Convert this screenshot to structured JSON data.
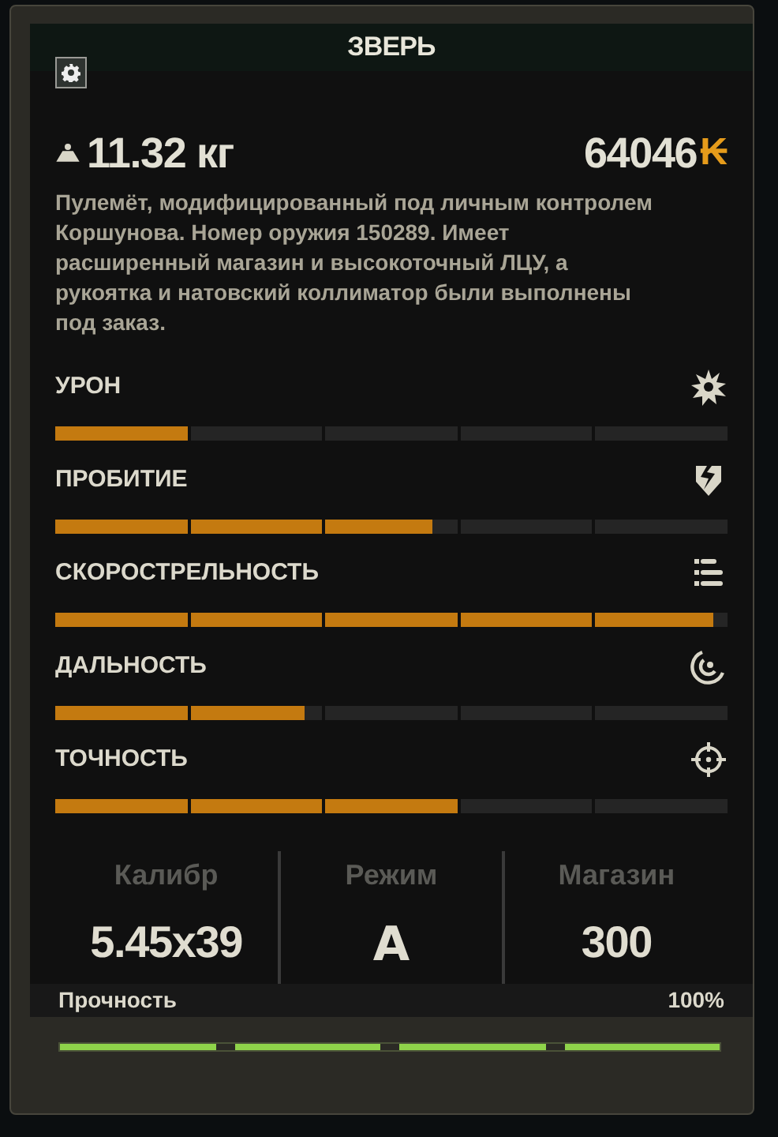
{
  "title": "ЗВЕРЬ",
  "weight": "11.32 кг",
  "price": "64046",
  "currency": "₭",
  "description": "Пулемёт, модифицированный под личным контролем Коршунова. Номер оружия 150289. Имеет расширенный магазин и высокоточный ЛЦУ, а рукоятка и натовский коллиматор были выполнены под заказ.",
  "stats": [
    {
      "label": "УРОН",
      "kind": "burst",
      "level": 0.2
    },
    {
      "label": "ПРОБИТИЕ",
      "kind": "penetration",
      "level": 0.56
    },
    {
      "label": "СКОРОСТРЕЛЬНОСТЬ",
      "kind": "rate",
      "level": 0.98
    },
    {
      "label": "ДАЛЬНОСТЬ",
      "kind": "range",
      "level": 0.37
    },
    {
      "label": "ТОЧНОСТЬ",
      "kind": "accuracy",
      "level": 0.6
    }
  ],
  "specs": [
    {
      "label": "Калибр",
      "value": "5.45x39",
      "kind": "text"
    },
    {
      "label": "Режим",
      "value": "A",
      "kind": "mode"
    },
    {
      "label": "Магазин",
      "value": "300",
      "kind": "text"
    }
  ],
  "durability": {
    "label": "Прочность",
    "value": "100%",
    "level": 1
  }
}
